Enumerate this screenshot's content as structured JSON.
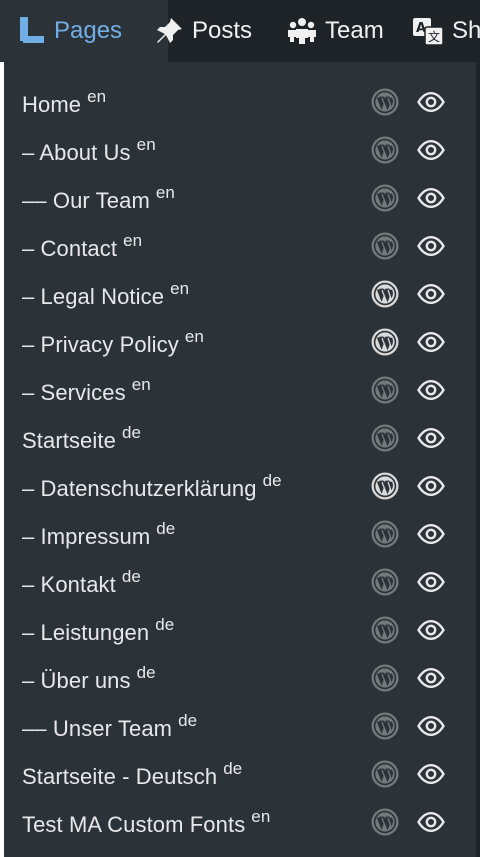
{
  "toolbar": {
    "tabs": [
      {
        "label": "Pages",
        "icon": "pages-icon",
        "active": true
      },
      {
        "label": "Posts",
        "icon": "pin-icon",
        "active": false
      },
      {
        "label": "Team",
        "icon": "team-icon",
        "active": false
      },
      {
        "label": "Sh",
        "icon": "translate-icon",
        "active": false
      }
    ]
  },
  "pages": [
    {
      "title": "Home",
      "lang": "en",
      "wp_bright": false
    },
    {
      "title": "– About Us",
      "lang": "en",
      "wp_bright": false
    },
    {
      "title": "–– Our Team",
      "lang": "en",
      "wp_bright": false
    },
    {
      "title": "– Contact",
      "lang": "en",
      "wp_bright": false
    },
    {
      "title": "– Legal Notice",
      "lang": "en",
      "wp_bright": true
    },
    {
      "title": "– Privacy Policy",
      "lang": "en",
      "wp_bright": true
    },
    {
      "title": "– Services",
      "lang": "en",
      "wp_bright": false
    },
    {
      "title": "Startseite",
      "lang": "de",
      "wp_bright": false
    },
    {
      "title": "– Datenschutzerklärung",
      "lang": "de",
      "wp_bright": true
    },
    {
      "title": "– Impressum",
      "lang": "de",
      "wp_bright": false
    },
    {
      "title": "– Kontakt",
      "lang": "de",
      "wp_bright": false
    },
    {
      "title": "– Leistungen",
      "lang": "de",
      "wp_bright": false
    },
    {
      "title": "– Über uns",
      "lang": "de",
      "wp_bright": false
    },
    {
      "title": "–– Unser Team",
      "lang": "de",
      "wp_bright": false
    },
    {
      "title": "Startseite - Deutsch",
      "lang": "de",
      "wp_bright": false
    },
    {
      "title": "Test MA Custom Fonts",
      "lang": "en",
      "wp_bright": false
    }
  ],
  "colors": {
    "accent": "#72aee6",
    "toolbar_bg": "#1d2327",
    "dropdown_bg": "#2c3338",
    "text": "#e8e8ea"
  }
}
